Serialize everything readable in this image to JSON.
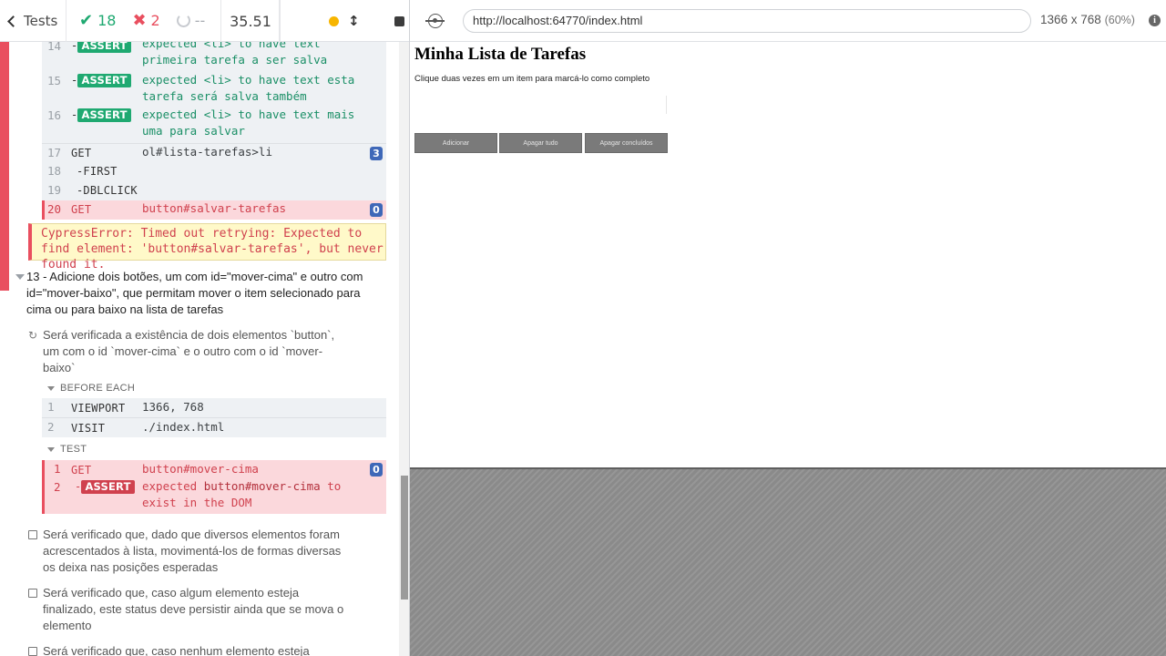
{
  "header": {
    "tests_label": "Tests",
    "passed": "18",
    "failed": "2",
    "pending": "--",
    "duration": "35.51"
  },
  "commands_top": [
    {
      "num": "14",
      "name": "-",
      "badge": "ASSERT",
      "msg": "expected <li> to have text primeira tarefa a ser salva"
    },
    {
      "num": "15",
      "name": "-",
      "badge": "ASSERT",
      "msg": "expected <li> to have text esta tarefa será salva também"
    },
    {
      "num": "16",
      "name": "-",
      "badge": "ASSERT",
      "msg": "expected <li> to have text mais uma para salvar"
    },
    {
      "num": "17",
      "name": "GET",
      "msg": "ol#lista-tarefas>li",
      "count": "3"
    },
    {
      "num": "18",
      "name": "-FIRST",
      "msg": ""
    },
    {
      "num": "19",
      "name": "-DBLCLICK",
      "msg": ""
    },
    {
      "num": "20",
      "name": "GET",
      "msg": "button#salvar-tarefas",
      "count": "0"
    }
  ],
  "error": {
    "text": "CypressError: Timed out retrying: Expected to find element: 'button#salvar-tarefas', but never found it."
  },
  "suite13": {
    "title": "13 - Adicione dois botões, um com id=\"mover-cima\" e outro com id=\"mover-baixo\", que permitam mover o item selecionado para cima ou para baixo na lista de tarefas"
  },
  "test_running": {
    "title": "Será verificada a existência de dois elementos `button`, um com o id `mover-cima` e o outro com o id `mover-baixo`"
  },
  "before_each": {
    "label": "BEFORE EACH",
    "commands": [
      {
        "num": "1",
        "name": "VIEWPORT",
        "msg": "1366, 768"
      },
      {
        "num": "2",
        "name": "VISIT",
        "msg": "./index.html"
      }
    ]
  },
  "test_section": {
    "label": "TEST",
    "commands": [
      {
        "num": "1",
        "name": "GET",
        "msg": "button#mover-cima",
        "count": "0"
      },
      {
        "num": "2",
        "name": "-",
        "badge": "ASSERT",
        "msg_a": "expected",
        "msg_b": "button#mover-cima",
        "msg_c": "to exist in the DOM"
      }
    ]
  },
  "pending_tests": [
    {
      "title": "Será verificado que, dado que diversos elementos foram acrescentados à lista, movimentá-los de formas diversas os deixa nas posições esperadas"
    },
    {
      "title": "Será verificado que, caso algum elemento esteja finalizado, este status deve persistir ainda que se mova o elemento"
    },
    {
      "title": "Será verificado que, caso nenhum elemento esteja"
    }
  ],
  "browser": {
    "url": "http://localhost:64770/index.html",
    "viewport": "1366 x 768",
    "scale": "(60%)",
    "info": "i"
  },
  "aut": {
    "title": "Minha Lista de Tarefas",
    "instructions": "Clique duas vezes em um item para marcá-lo como completo",
    "buttons": [
      "Adicionar",
      "Apagar tudo",
      "Apagar concluídos"
    ]
  },
  "colors": {
    "pass": "#1fa971",
    "fail": "#e94f5f",
    "badge_blue": "#3f68b8"
  }
}
